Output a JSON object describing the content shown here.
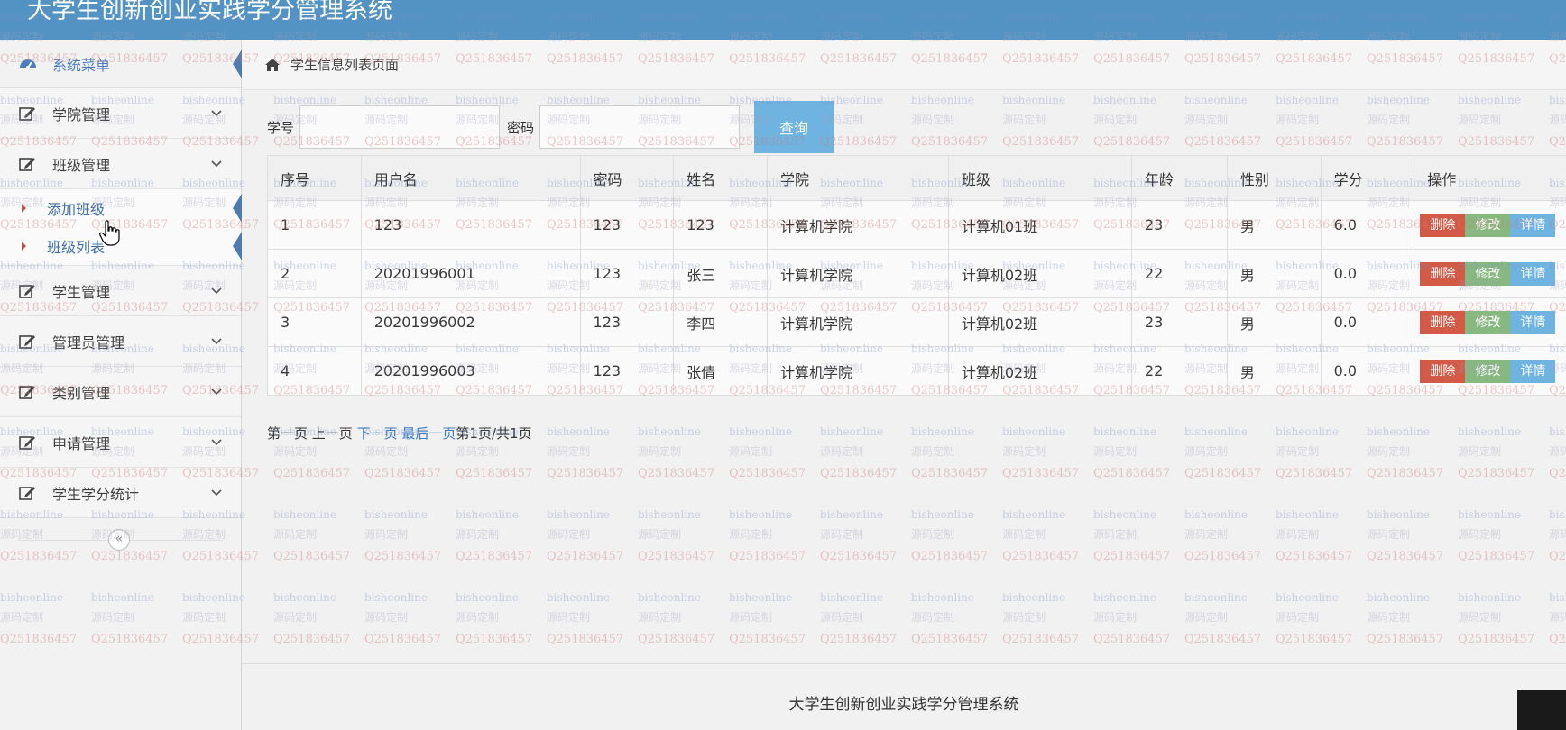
{
  "app": {
    "title": "大学生创新创业实践学分管理系统"
  },
  "sidebar": {
    "header": "系统菜单",
    "items": [
      {
        "label": "学院管理"
      },
      {
        "label": "班级管理",
        "expanded": true,
        "children": [
          {
            "label": "添加班级"
          },
          {
            "label": "班级列表"
          }
        ]
      },
      {
        "label": "学生管理"
      },
      {
        "label": "管理员管理"
      },
      {
        "label": "类别管理"
      },
      {
        "label": "申请管理"
      },
      {
        "label": "学生学分统计"
      }
    ],
    "collapse_glyph": "«"
  },
  "breadcrumb": {
    "title": "学生信息列表页面"
  },
  "search": {
    "field1_label": "学号",
    "field1_value": "",
    "field2_label": "密码",
    "field2_value": "",
    "button_label": "查询"
  },
  "table": {
    "columns": [
      "序号",
      "用户名",
      "密码",
      "姓名",
      "学院",
      "班级",
      "年龄",
      "性别",
      "学分",
      "操作"
    ],
    "rows": [
      {
        "index": "1",
        "username": "123",
        "password": "123",
        "name": "123",
        "college": "计算机学院",
        "class": "计算机01班",
        "age": "23",
        "gender": "男",
        "credits": "6.0"
      },
      {
        "index": "2",
        "username": "20201996001",
        "password": "123",
        "name": "张三",
        "college": "计算机学院",
        "class": "计算机02班",
        "age": "22",
        "gender": "男",
        "credits": "0.0"
      },
      {
        "index": "3",
        "username": "20201996002",
        "password": "123",
        "name": "李四",
        "college": "计算机学院",
        "class": "计算机02班",
        "age": "23",
        "gender": "男",
        "credits": "0.0"
      },
      {
        "index": "4",
        "username": "20201996003",
        "password": "123",
        "name": "张倩",
        "college": "计算机学院",
        "class": "计算机02班",
        "age": "22",
        "gender": "男",
        "credits": "0.0"
      }
    ],
    "actions": {
      "delete": "删除",
      "edit": "修改",
      "detail": "详情"
    }
  },
  "pagination": {
    "first": "第一页",
    "prev": "上一页",
    "next": "下一页",
    "last": "最后一页",
    "status": "第1页/共1页"
  },
  "footer": {
    "text": "大学生创新创业实践学分管理系统"
  },
  "watermark": {
    "site": "bisheonline",
    "tag": "源码定制",
    "qq": "Q2518364​57"
  },
  "colors": {
    "header": "#5393c3",
    "delete": "#d15b47",
    "edit": "#87b87f",
    "detail": "#6fb3e0",
    "search_button": "#6fb3e0"
  }
}
